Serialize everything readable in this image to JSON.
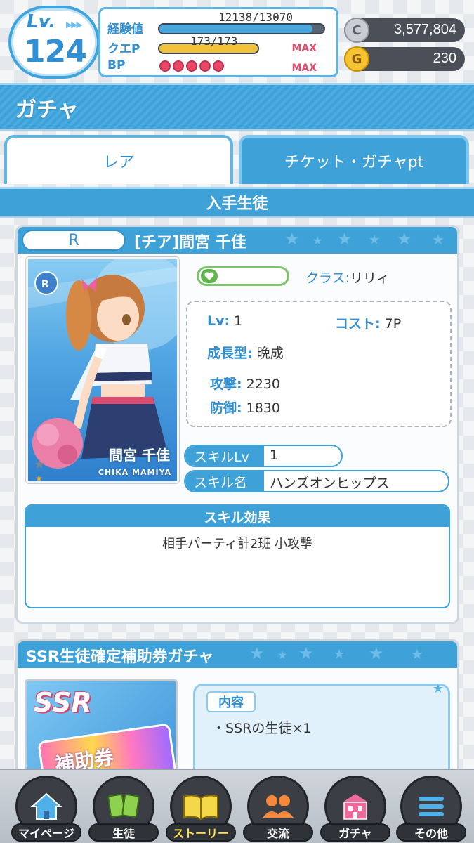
{
  "player": {
    "level_prefix": "Lv.",
    "level": "124",
    "exp_label": "経験値",
    "exp_text": "12138/13070",
    "exp_fraction": 0.93,
    "quest_label": "クエP",
    "quest_text": "173/173",
    "quest_fraction": 1.0,
    "quest_max": "MAX",
    "bp_label": "BP",
    "bp_count": 5,
    "bp_max": "MAX"
  },
  "currency": {
    "coin_symbol": "C",
    "coin_value": "3,577,804",
    "gem_symbol": "G",
    "gem_value": "230"
  },
  "page": {
    "title": "ガチャ"
  },
  "tabs": [
    {
      "label": "レア",
      "active": false
    },
    {
      "label": "チケット・ガチャpt",
      "active": true
    }
  ],
  "section_title": "入手生徒",
  "character": {
    "rarity": "R",
    "name": "[チア]間宮 千佳",
    "card_name": "間宮 千佳",
    "card_name_roman": "CHIKA MAMIYA",
    "class_label": "クラス:",
    "class_value": "リリィ",
    "stats": [
      {
        "key": "Lv:",
        "value": "1"
      },
      {
        "key": "コスト:",
        "value": "7P"
      },
      {
        "key": "成長型:",
        "value": "晩成"
      },
      {
        "key": "攻撃:",
        "value": "2230"
      },
      {
        "key": "防御:",
        "value": "1830"
      }
    ],
    "skill_lv_label": "スキルLv",
    "skill_lv_value": "1",
    "skill_name_label": "スキル名",
    "skill_name_value": "ハンズオンヒップス",
    "effect_label": "スキル効果",
    "effect_text": "相手パーティ計2班 小攻撃"
  },
  "ssr_panel": {
    "title": "SSR生徒確定補助券ガチャ",
    "art_label": "SSR",
    "ticket_text": "補助券",
    "contents_tag": "内容",
    "contents_item": "・SSRの生徒×1"
  },
  "nav": [
    {
      "label": "マイページ",
      "icon": "home-icon"
    },
    {
      "label": "生徒",
      "icon": "cards-icon"
    },
    {
      "label": "ストーリー",
      "icon": "book-icon"
    },
    {
      "label": "交流",
      "icon": "people-icon"
    },
    {
      "label": "ガチャ",
      "icon": "shop-icon"
    },
    {
      "label": "その他",
      "icon": "menu-icon"
    }
  ],
  "colors": {
    "accent": "#3ea2d8",
    "max_text": "#e24a6a",
    "bp_dot": "#e84866",
    "affinity": "#5cb54a"
  }
}
